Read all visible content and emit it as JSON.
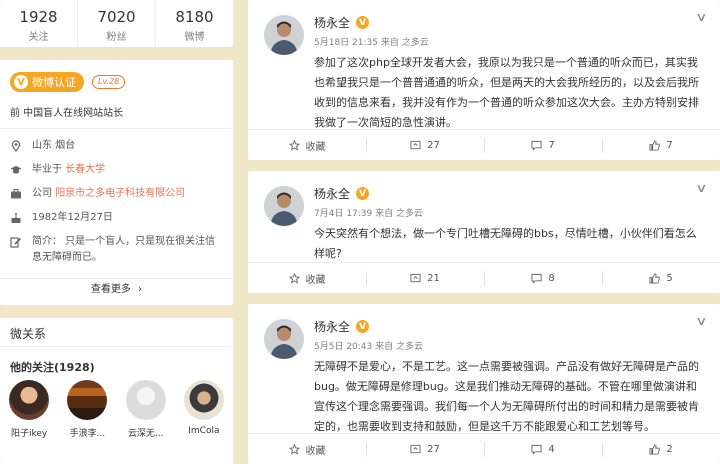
{
  "stats": [
    {
      "num": "1928",
      "label": "关注"
    },
    {
      "num": "7020",
      "label": "粉丝"
    },
    {
      "num": "8180",
      "label": "微博"
    }
  ],
  "profile": {
    "verify_badge": "微博认证",
    "level": "Lv.28",
    "verify_desc": "前 中国盲人在线网站站长",
    "location": "山东 烟台",
    "school_prefix": "毕业于",
    "school": "长春大学",
    "company_prefix": "公司",
    "company": "阳泉市之多电子科技有限公司",
    "birthday": "1982年12月27日",
    "bio": "简介：  只是一个盲人，只是现在很关注信息无障碍而已。",
    "more": "查看更多"
  },
  "relations": {
    "title": "微关系",
    "follow_title": "他的关注(1928)",
    "follows": [
      {
        "name": "阳子ikey"
      },
      {
        "name": "手浪李..."
      },
      {
        "name": "云深无..."
      },
      {
        "name": "ImCola"
      }
    ]
  },
  "posts": [
    {
      "author": "杨永全",
      "meta": "5月18日 21:35 来自 之多云",
      "content": "参加了这次php全球开发者大会，我原以为我只是一个普通的听众而已，其实我也希望我只是一个普普通通的听众，但是两天的大会我所经历的，以及会后我所收到的信息来看，我并没有作为一个普通的听众参加这次大会。主办方特别安排我做了一次简短的急性演讲。",
      "fav": "收藏",
      "repost": "27",
      "comment": "7",
      "like": "7"
    },
    {
      "author": "杨永全",
      "meta": "7月4日 17:39 来自 之多云",
      "content": "今天突然有个想法，做一个专门吐槽无障碍的bbs，尽情吐槽，小伙伴们看怎么样呢?",
      "fav": "收藏",
      "repost": "21",
      "comment": "8",
      "like": "5"
    },
    {
      "author": "杨永全",
      "meta": "5月5日 20:43 来自 之多云",
      "content": "无障碍不是爱心，不是工艺。这一点需要被强调。产品没有做好无障碍是产品的bug。做无障碍是修理bug。这是我们推动无障碍的基础。不管在哪里做演讲和宣传这个理念需要强调。我们每一个人为无障碍所付出的时间和精力是需要被肯定的，也需要收到支持和鼓励，但是这千万不能跟爱心和工艺划等号。",
      "fav": "收藏",
      "repost": "27",
      "comment": "4",
      "like": "2"
    }
  ]
}
